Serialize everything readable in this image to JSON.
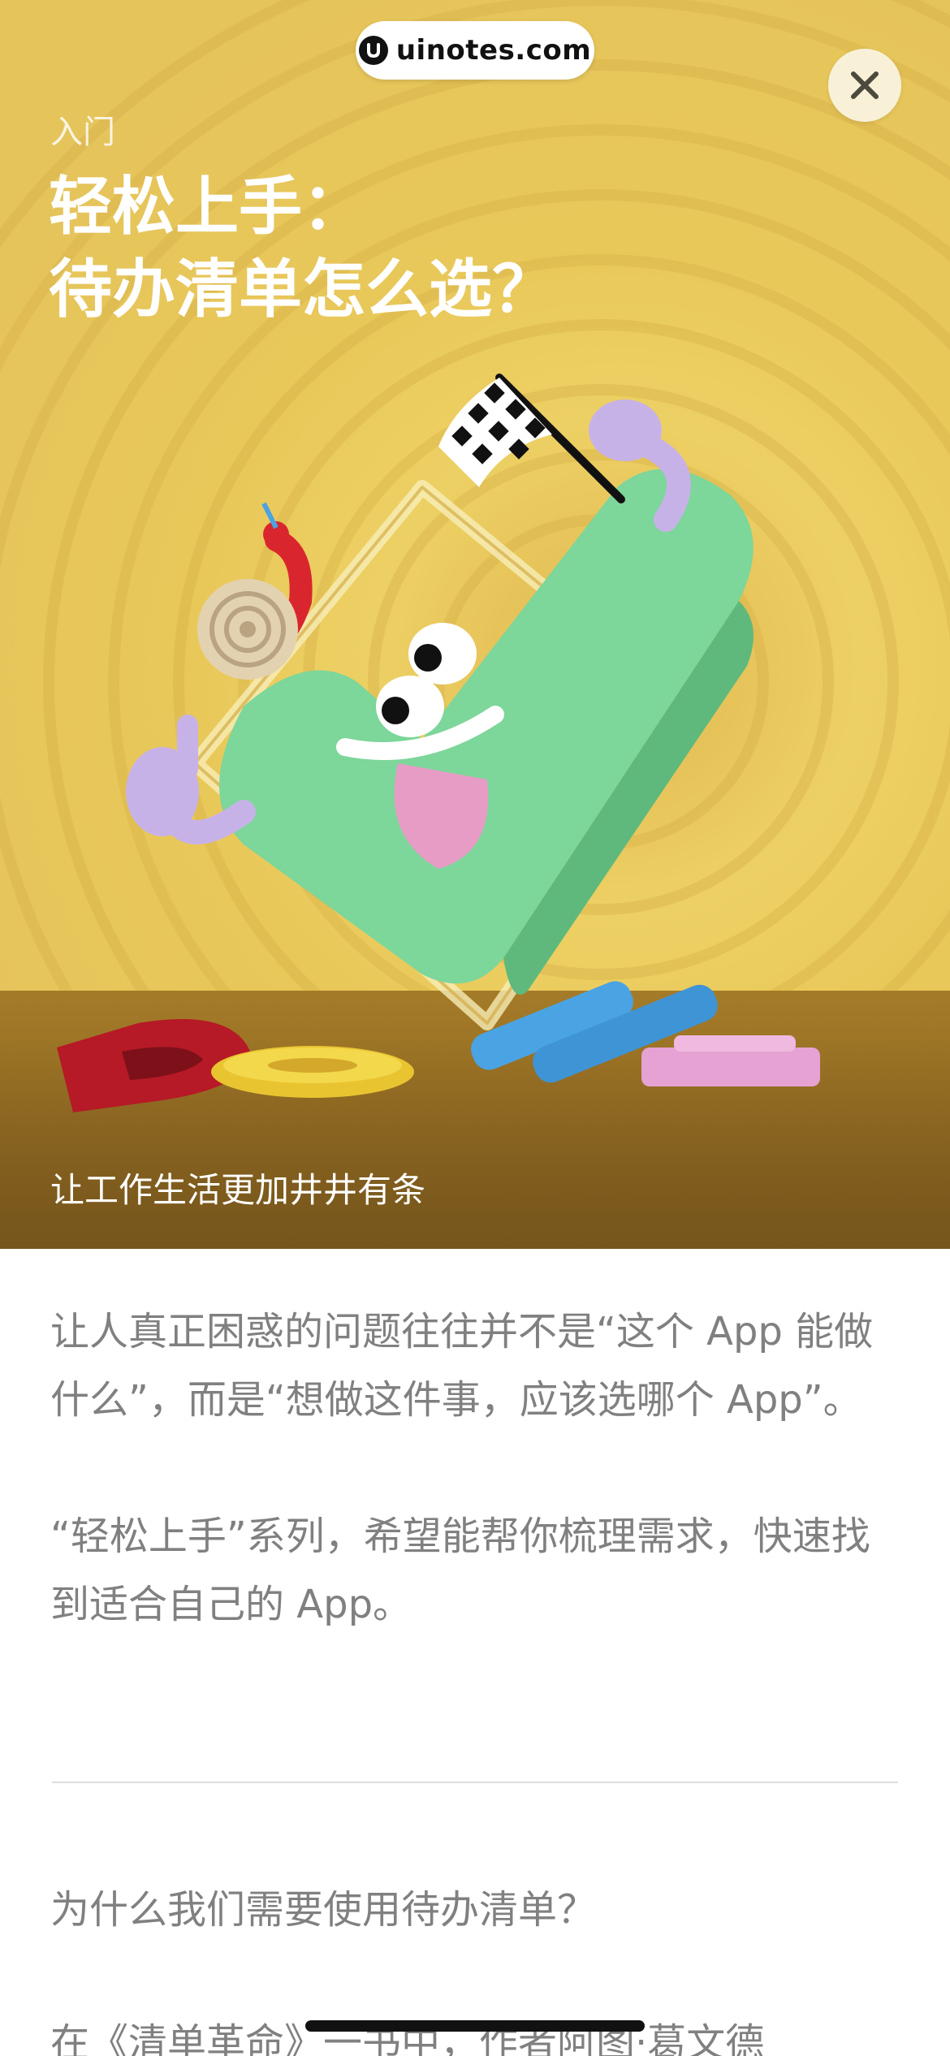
{
  "watermark": {
    "text": "uinotes.com"
  },
  "close_button": {
    "icon": "close-icon"
  },
  "hero": {
    "eyebrow": "入门",
    "title_line1": "轻松上手：",
    "title_line2": "待办清单怎么选？",
    "caption": "让工作生活更加井井有条",
    "colors": {
      "background": "#e8c65a",
      "floor": "#8c6622",
      "character": "#7dd69a"
    }
  },
  "article": {
    "paragraph1": "让人真正困惑的问题往往并不是“这个 App 能做什么”，而是“想做这件事，应该选哪个 App”。",
    "paragraph2": "“轻松上手”系列，希望能帮你梳理需求，快速找到适合自己的 App。",
    "section_heading": "为什么我们需要使用待办清单？",
    "paragraph3_partial": "在《清单革命》一书中，作者阿图·葛文德"
  }
}
